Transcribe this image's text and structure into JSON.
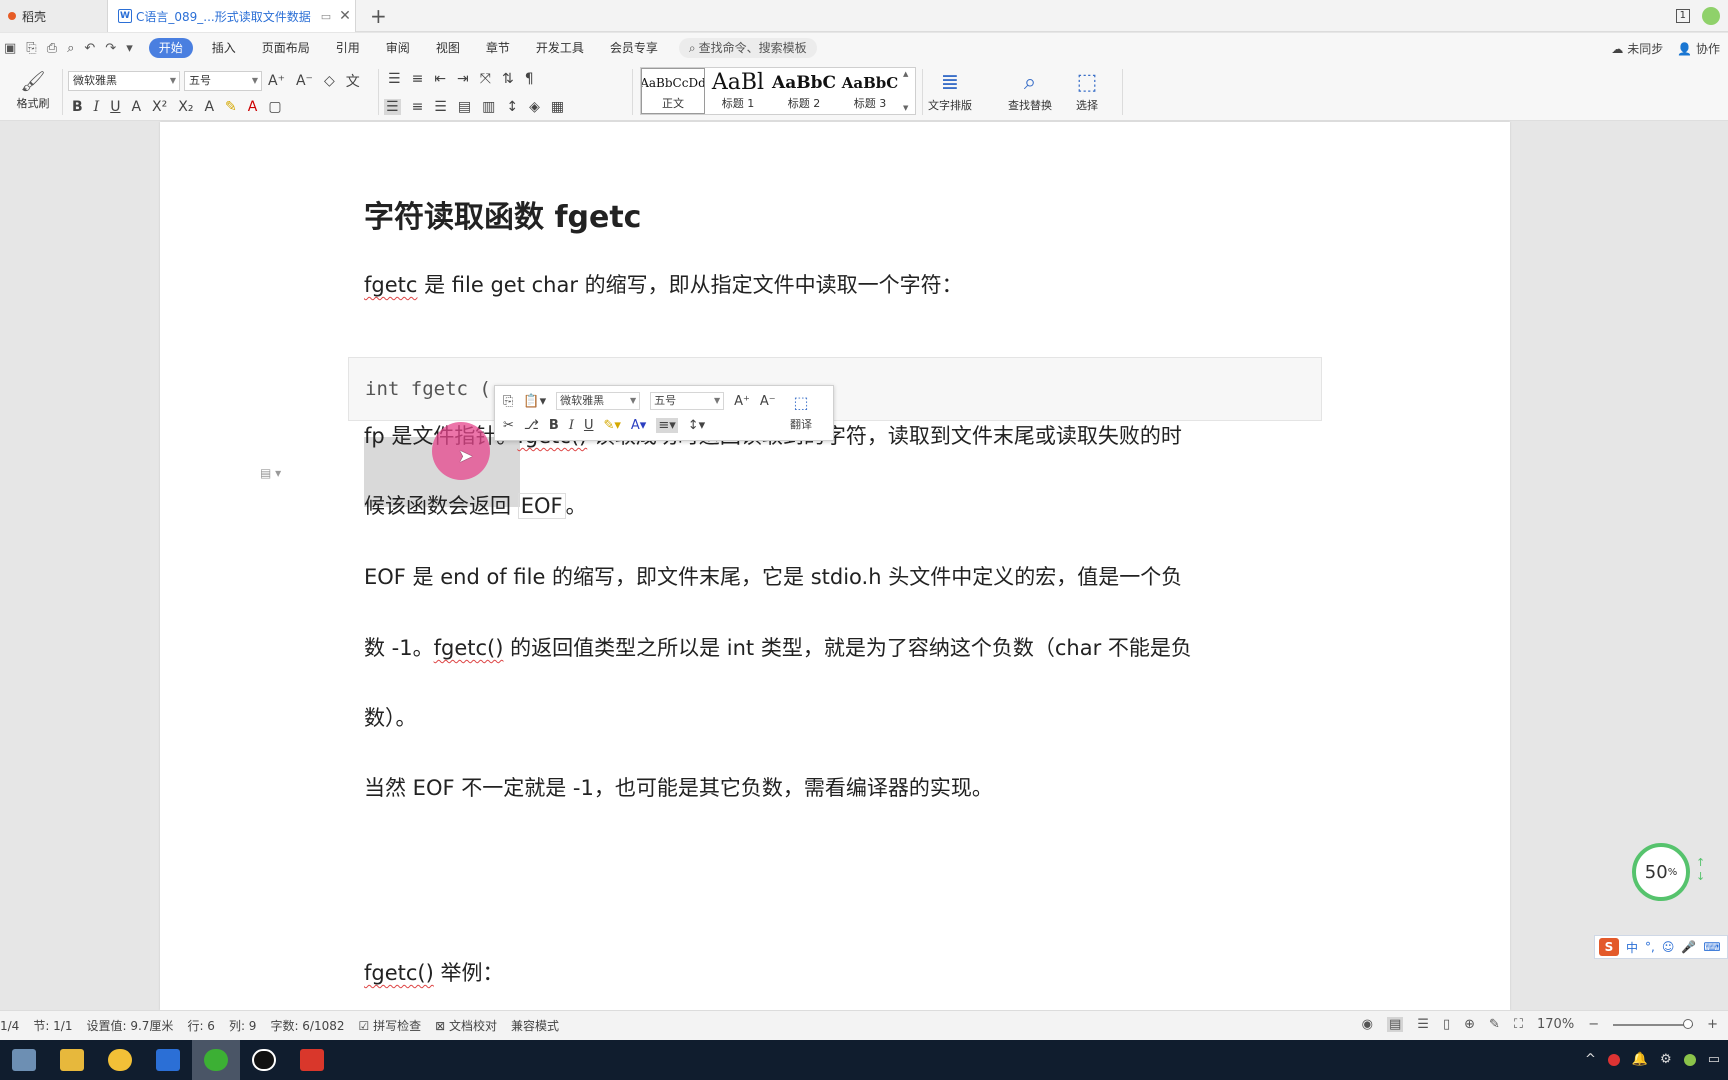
{
  "titlebar": {
    "home_tab": "稻壳",
    "doc_tab": "C语言_089_...形式读取文件数据",
    "doc_badge": "W",
    "new_tab": "+",
    "page_indicator": "1"
  },
  "menu": {
    "items": [
      "开始",
      "插入",
      "页面布局",
      "引用",
      "审阅",
      "视图",
      "章节",
      "开发工具",
      "会员专享"
    ],
    "search_placeholder": "查找命令、搜索模板",
    "right": [
      "未同步",
      "协作"
    ]
  },
  "ribbon": {
    "format_brush": "格式刷",
    "font_name": "微软雅黑",
    "font_size": "五号",
    "styles": [
      {
        "sample": "AaBbCcDd",
        "name": "正文"
      },
      {
        "sample": "AaBl",
        "name": "标题 1"
      },
      {
        "sample": "AaBbC",
        "name": "标题 2"
      },
      {
        "sample": "AaBbC",
        "name": "标题 3"
      }
    ],
    "text_layout": "文字排版",
    "find_replace": "查找替换",
    "select": "选择"
  },
  "document": {
    "heading": "字符读取函数 fgetc",
    "p1_prefix": "fgetc",
    "p1_rest": " 是 file get char 的缩写，即从指定文件中读取一个字符：",
    "code": "int fgetc (",
    "p3_a": "fp 是文件指针。",
    "p3_b": "fgetc()",
    "p3_c": " 读取成功时返回读取到的字符，读取到文件末尾或读取失败的时",
    "p3_line2_a": "候该函数会返回 ",
    "p3_line2_eof": "EOF",
    "p3_line2_b": "。",
    "p4_line1": "EOF 是 end of file 的缩写，即文件末尾，它是 stdio.h 头文件中定义的宏，值是一个负",
    "p4_line2_a": "数 -1。",
    "p4_line2_b": "fgetc()",
    "p4_line2_c": " 的返回值类型之所以是 int 类型，就是为了容纳这个负数（char 不能是负",
    "p4_line3": "数）。",
    "p5": "当然 EOF 不一定就是 -1，也可能是其它负数，需看编译器的实现。",
    "p6_a": "fgetc()",
    "p6_b": " 举例："
  },
  "mini_toolbar": {
    "font_name": "微软雅黑",
    "font_size": "五号",
    "translate": "翻译"
  },
  "widgets": {
    "zoom_ring_value": "50",
    "zoom_ring_unit": "%",
    "ime_lang": "中"
  },
  "statusbar": {
    "page": "1/4",
    "section": "节: 1/1",
    "setting": "设置值: 9.7厘米",
    "row": "行: 6",
    "col": "列: 9",
    "wordcount": "字数: 6/1082",
    "spell_check": "拼写检查",
    "doc_proof": "文档校对",
    "compat_mode": "兼容模式",
    "zoom": "170%"
  },
  "colors": {
    "accent": "#4a7fe0",
    "cursor_highlight": "#e6468c",
    "zoom_ring": "#56c36d",
    "taskbar": "#101d2e"
  }
}
